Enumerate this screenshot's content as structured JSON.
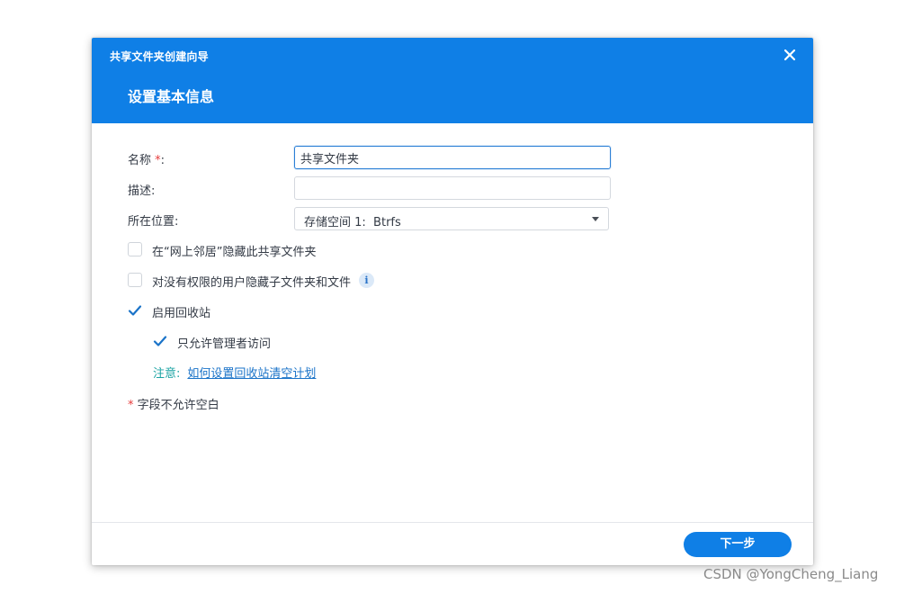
{
  "dialog": {
    "title": "共享文件夹创建向导",
    "step_title": "设置基本信息"
  },
  "form": {
    "name": {
      "label": "名称",
      "required_mark": "*",
      "colon": ":",
      "value": "共享文件夹"
    },
    "description": {
      "label": "描述:",
      "value": ""
    },
    "location": {
      "label": "所在位置:",
      "selected": "存储空间 1:  Btrfs"
    }
  },
  "options": {
    "hide_network": {
      "label": "在“网上邻居”隐藏此共享文件夹",
      "checked": false
    },
    "hide_subfolders": {
      "label": "对没有权限的用户隐藏子文件夹和文件",
      "checked": false
    },
    "recycle_bin": {
      "label": "启用回收站",
      "checked": true
    },
    "admin_only": {
      "label": "只允许管理者访问",
      "checked": true
    }
  },
  "note": {
    "label": "注意:",
    "link": "如何设置回收站清空计划"
  },
  "required_note": {
    "star": "*",
    "text": "字段不允许空白"
  },
  "footer": {
    "next_label": "下一步"
  },
  "watermark": "CSDN @YongCheng_Liang",
  "colors": {
    "accent": "#0f7fe6",
    "required": "#e63c3c",
    "note": "#1aa3a3",
    "link": "#1a73c8",
    "check": "#1a73c8"
  },
  "icons": {
    "close": "close-icon",
    "info": "info-icon",
    "check": "checkmark-icon",
    "caret": "caret-down-icon"
  }
}
